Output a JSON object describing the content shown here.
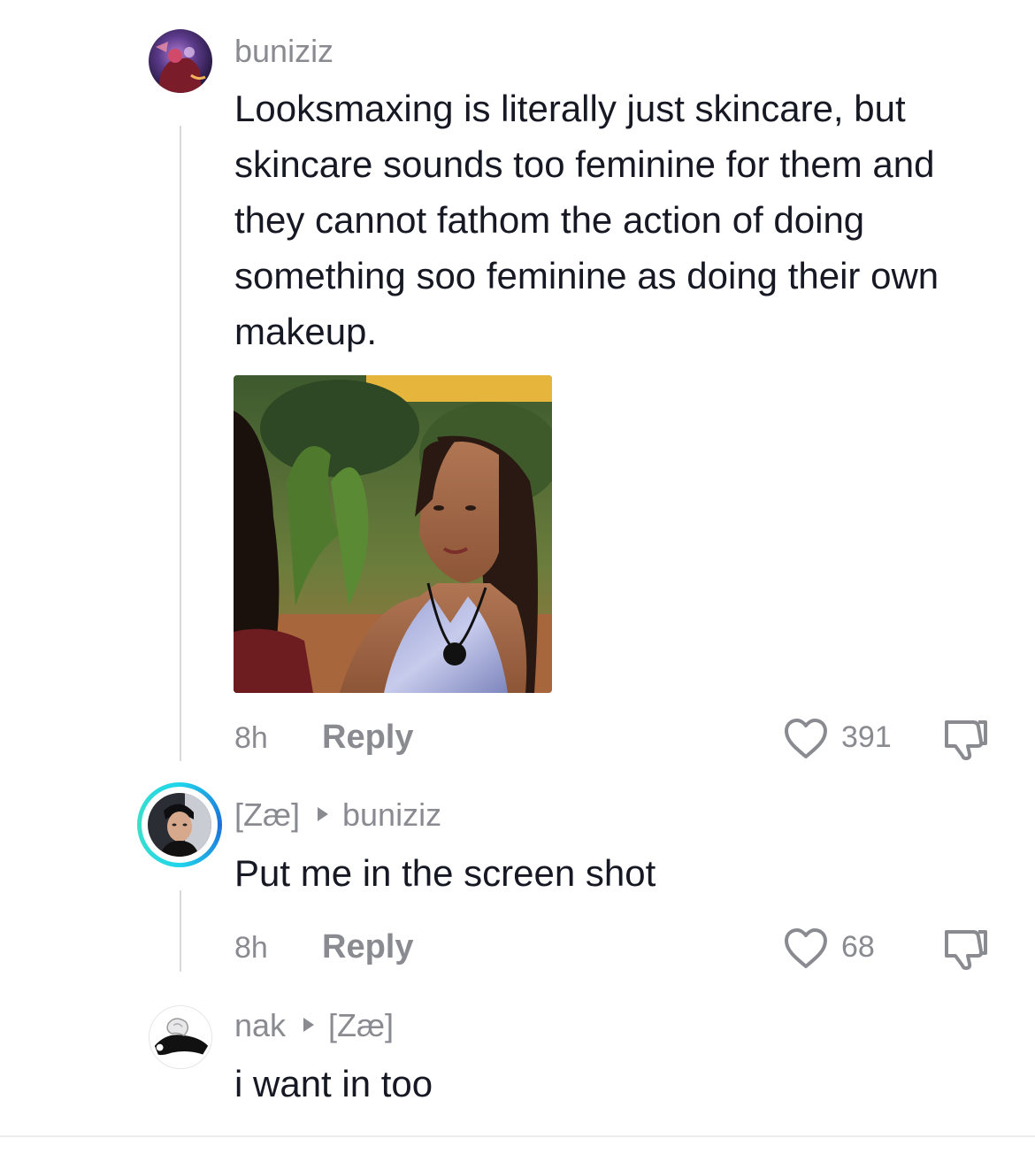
{
  "comments": [
    {
      "username": "buniziz",
      "text": "Looksmaxing is literally just skincare, but skincare sounds too feminine for them and they cannot fathom the action of doing something soo feminine as doing their own makeup.",
      "time": "8h",
      "reply_label": "Reply",
      "likes": "391"
    },
    {
      "username": "[Zæ]",
      "reply_to": "buniziz",
      "text": "Put me in the screen shot",
      "time": "8h",
      "reply_label": "Reply",
      "likes": "68"
    },
    {
      "username": "nak",
      "reply_to": "[Zæ]",
      "text": "i want in too"
    }
  ],
  "colors": {
    "text_primary": "#161823",
    "text_secondary": "#8a8b91",
    "story_ring_start": "#20d5ec",
    "story_ring_end": "#1e6fd9"
  },
  "icons": {
    "like": "heart-outline-icon",
    "dislike": "thumbs-down-outline-icon"
  }
}
